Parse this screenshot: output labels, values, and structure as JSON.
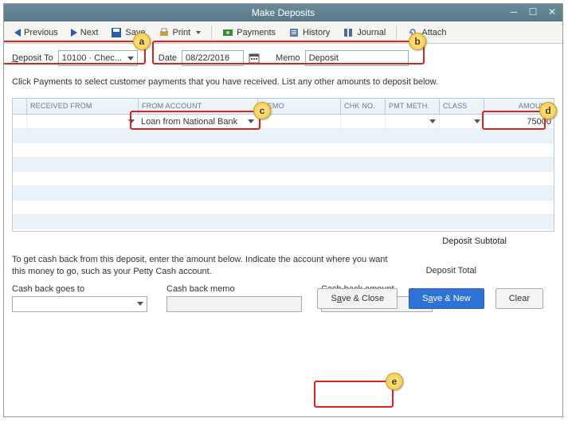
{
  "window": {
    "title": "Make Deposits"
  },
  "toolbar": {
    "previous": "Previous",
    "next": "Next",
    "save": "Save",
    "print": "Print",
    "payments": "Payments",
    "history": "History",
    "journal": "Journal",
    "attach": "Attach"
  },
  "deposit": {
    "deposit_to_label_pre": "D",
    "deposit_to_label_post": "eposit To",
    "deposit_to_value": "10100 · Chec...",
    "date_label": "Date",
    "date_value": "08/22/2016",
    "memo_label": "Memo",
    "memo_value": "Deposit"
  },
  "instruction": "Click Payments to select customer payments that you have received. List any other amounts to deposit below.",
  "grid": {
    "headers": {
      "received_from": "RECEIVED FROM",
      "from_account": "FROM ACCOUNT",
      "memo": "MEMO",
      "chk_no": "CHK NO.",
      "pmt_meth": "PMT METH.",
      "class": "CLASS",
      "amount": "AMOUNT"
    },
    "rows": [
      {
        "received_from": "",
        "from_account": "Loan from National Bank",
        "memo": "",
        "chk_no": "",
        "pmt_meth": "",
        "class": "",
        "amount": "75000"
      }
    ]
  },
  "subtotal_label": "Deposit Subtotal",
  "cashback": {
    "instruction": "To get cash back from this deposit, enter the amount below.  Indicate the account where you want this money to go, such as your Petty Cash account.",
    "goes_to_label": "Cash back goes to",
    "memo_label": "Cash back memo",
    "amount_label": "Cash back amount"
  },
  "total_label": "Deposit Total",
  "buttons": {
    "save_close_pre": "S",
    "save_close_mid": "a",
    "save_close_post": "ve & Close",
    "save_new_pre": "S",
    "save_new_mid": "a",
    "save_new_post": "ve & New",
    "clear": "Clear"
  },
  "callouts": {
    "a": "a",
    "b": "b",
    "c": "c",
    "d": "d",
    "e": "e"
  }
}
